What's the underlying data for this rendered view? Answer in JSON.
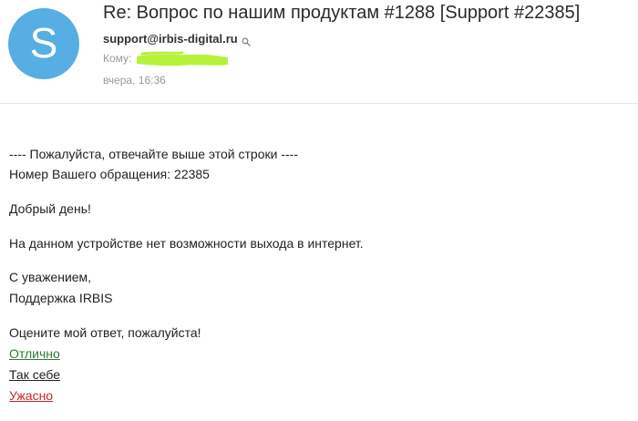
{
  "header": {
    "avatar_letter": "S",
    "subject": "Re: Вопрос по нашим продуктам #1288 [Support #22385]",
    "sender_email": "support@irbis-digital.ru",
    "to_label": "Кому:",
    "date": "вчера, 16:36"
  },
  "icons": {
    "search": "search-icon"
  },
  "colors": {
    "avatar_bg": "#56aee3",
    "redaction": "#b6f23a",
    "link_excellent": "#2e7d32",
    "link_average": "#222222",
    "link_awful": "#c62828"
  },
  "body": {
    "line1": "---- Пожалуйста, отвечайте выше этой строки ----",
    "line2": "Номер Вашего обращения: 22385",
    "greeting": "Добрый день!",
    "message": "На данном устройстве нет возможности выхода в интернет.",
    "regards": "С уважением,",
    "signature": "Поддержка IRBIS",
    "rating_prompt": "Оцените мой ответ, пожалуйста!"
  },
  "rating_links": [
    {
      "label": "Отлично"
    },
    {
      "label": "Так себе"
    },
    {
      "label": "Ужасно"
    }
  ]
}
